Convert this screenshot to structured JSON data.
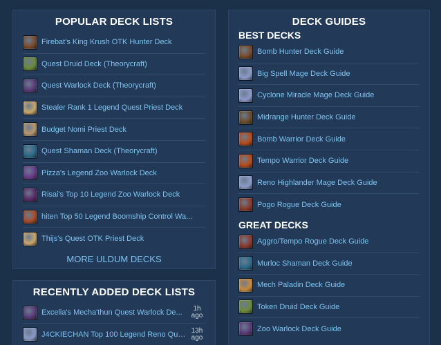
{
  "popular": {
    "title": "POPULAR DECK LISTS",
    "items": [
      {
        "label": "Firebat's King Krush OTK Hunter Deck",
        "icon": "hunter-class-icon",
        "color": "#7a4a2a"
      },
      {
        "label": "Quest Druid Deck (Theorycraft)",
        "icon": "druid-class-icon",
        "color": "#6b8a3a"
      },
      {
        "label": "Quest Warlock Deck (Theorycraft)",
        "icon": "warlock-class-icon",
        "color": "#5a3a7a"
      },
      {
        "label": "Stealer Rank 1 Legend Quest Priest Deck",
        "icon": "priest-class-icon",
        "color": "#c9a66b"
      },
      {
        "label": "Budget Nomi Priest Deck",
        "icon": "priest-class-icon",
        "color": "#b9966b"
      },
      {
        "label": "Quest Shaman Deck (Theorycraft)",
        "icon": "shaman-class-icon",
        "color": "#2a6a8a"
      },
      {
        "label": "Pizza's Legend Zoo Warlock Deck",
        "icon": "warlock-class-icon",
        "color": "#6a3a8a"
      },
      {
        "label": "Risai's Top 10 Legend Zoo Warlock Deck",
        "icon": "warlock-class-icon",
        "color": "#5a2a6a"
      },
      {
        "label": "hiten Top 50 Legend Boomship Control Wa...",
        "icon": "warrior-class-icon",
        "color": "#a84a2a"
      },
      {
        "label": "Thijs's Quest OTK Priest Deck",
        "icon": "priest-class-icon",
        "color": "#c9a66b"
      }
    ],
    "more_label": "MORE ULDUM DECKS"
  },
  "recent": {
    "title": "RECENTLY ADDED DECK LISTS",
    "items": [
      {
        "label": "Excelia's Mecha'thun Quest Warlock De...",
        "time_num": "1h",
        "time_unit": "ago",
        "icon": "warlock-class-icon",
        "color": "#5a3a7a"
      },
      {
        "label": "J4CKIECHAN Top 100 Legend Reno Que...",
        "time_num": "13h",
        "time_unit": "ago",
        "icon": "mage-class-icon",
        "color": "#8a9ac9"
      }
    ]
  },
  "guides": {
    "title": "DECK GUIDES",
    "best_heading": "BEST DECKS",
    "best": [
      {
        "label": "Bomb Hunter Deck Guide",
        "icon": "hunter-class-icon",
        "color": "#7a4a2a"
      },
      {
        "label": "Big Spell Mage Deck Guide",
        "icon": "mage-class-icon",
        "color": "#8a9ac9"
      },
      {
        "label": "Cyclone Miracle Mage Deck Guide",
        "icon": "mage-class-icon",
        "color": "#8a9ac9"
      },
      {
        "label": "Midrange Hunter Deck Guide",
        "icon": "hunter-class-icon",
        "color": "#6a4a2a"
      },
      {
        "label": "Bomb Warrior Deck Guide",
        "icon": "warrior-class-icon",
        "color": "#b84a1a"
      },
      {
        "label": "Tempo Warrior Deck Guide",
        "icon": "warrior-class-icon",
        "color": "#b84a1a"
      },
      {
        "label": "Reno Highlander Mage Deck Guide",
        "icon": "mage-class-icon",
        "color": "#8a9ac9"
      },
      {
        "label": "Pogo Rogue Deck Guide",
        "icon": "rogue-class-icon",
        "color": "#8a3a2a"
      }
    ],
    "great_heading": "GREAT DECKS",
    "great": [
      {
        "label": "Aggro/Tempo Rogue Deck Guide",
        "icon": "rogue-class-icon",
        "color": "#8a3a2a"
      },
      {
        "label": "Murloc Shaman Deck Guide",
        "icon": "shaman-class-icon",
        "color": "#2a6a8a"
      },
      {
        "label": "Mech Paladin Deck Guide",
        "icon": "paladin-class-icon",
        "color": "#c98a3a"
      },
      {
        "label": "Token Druid Deck Guide",
        "icon": "druid-class-icon",
        "color": "#6b8a3a"
      },
      {
        "label": "Zoo Warlock Deck Guide",
        "icon": "warlock-class-icon",
        "color": "#5a3a7a"
      }
    ]
  }
}
